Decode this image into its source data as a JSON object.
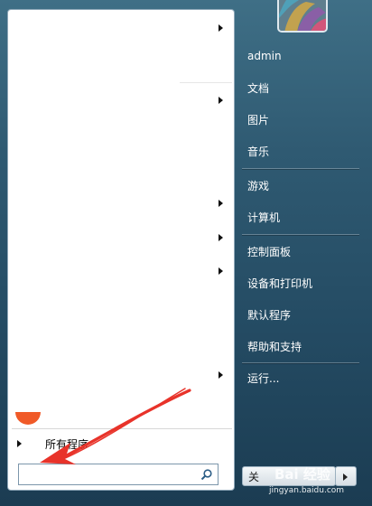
{
  "right_menu": {
    "user": "admin",
    "documents": "文档",
    "pictures": "图片",
    "music": "音乐",
    "games": "游戏",
    "computer": "计算机",
    "control_panel": "控制面板",
    "devices_printers": "设备和打印机",
    "default_programs": "默认程序",
    "help_support": "帮助和支持",
    "run": "运行..."
  },
  "left_menu": {
    "all_programs": "所有程序",
    "search_placeholder": ""
  },
  "shutdown": {
    "label": "关",
    "arrow_icon": "chevron-right-icon"
  },
  "watermark": {
    "brand": "Bai 经验",
    "url": "jingyan.baidu.com"
  },
  "icons": {
    "search": "search-icon",
    "user_avatar": "avatar"
  },
  "colors": {
    "annotation": "#e8332a",
    "taskbar_gradient_top": "#3f6f86",
    "taskbar_gradient_bottom": "#1b3c52"
  }
}
